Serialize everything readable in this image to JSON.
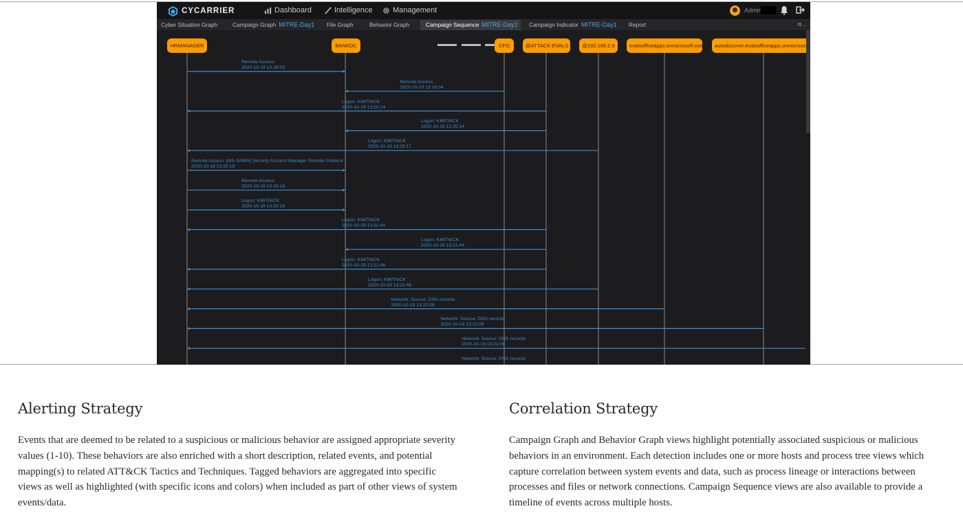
{
  "app": {
    "logo_text": "CYCARRIER",
    "nav": [
      {
        "label": "Dashboard",
        "icon": "bar-chart-icon"
      },
      {
        "label": "Intelligence",
        "icon": "wand-icon"
      },
      {
        "label": "Management",
        "icon": "gear-icon"
      }
    ],
    "user": "Admin",
    "tabs": [
      {
        "label": "Cyber Situation Graph",
        "sub": ""
      },
      {
        "label": "Campaign Graph",
        "sub": "MITRE-Day1"
      },
      {
        "label": "File Graph",
        "sub": ""
      },
      {
        "label": "Behavior Graph",
        "sub": ""
      },
      {
        "label": "Campaign Sequence",
        "sub": "MITRE-Day1",
        "active": true
      },
      {
        "label": "Campaign Indicator",
        "sub": "MITRE-Day1"
      },
      {
        "label": "Report",
        "sub": ""
      }
    ],
    "tab_icons": "⧉ ..",
    "colors": {
      "node": "#ff9d00",
      "line": "#3a8fd0",
      "background": "#1c1b1d"
    }
  },
  "sequence": {
    "actors": [
      "HRMANAGER",
      "BANKDC",
      "CFO",
      "@ATTACK-EVALS",
      "@192.168.2.9",
      "evalsofficeapps.onmicrosoft.com",
      "autodiscover.evalsofficeapps.onmicrosoft.com"
    ],
    "messages": [
      {
        "from": 0,
        "to": 1,
        "label": "Remote Access:",
        "time": "2020-10-19 13:18:03"
      },
      {
        "from": 2,
        "to": 1,
        "label": "Remote Access:",
        "time": "2020-10-19 13:18:04"
      },
      {
        "from": 3,
        "to": 0,
        "label": "Logon: KMITNICK",
        "time": "2020-10-19 13:20:14"
      },
      {
        "from": 3,
        "to": 1,
        "label": "Logon: KMITNICK",
        "time": "2020-10-19 13:20:14"
      },
      {
        "from": 4,
        "to": 0,
        "label": "Logon: KMITNICK",
        "time": "2020-10-19 13:20:17"
      },
      {
        "from": 0,
        "to": 1,
        "label": "Remote Access: [MS-SAMR] Security Account Manager Remote Protocol",
        "time": "2020-10-19 13:20:18"
      },
      {
        "from": 0,
        "to": 1,
        "label": "Remote Access:",
        "time": "2020-10-19 13:20:18"
      },
      {
        "from": 0,
        "to": 1,
        "label": "Logon: KMITNICK",
        "time": "2020-10-19 13:20:18"
      },
      {
        "from": 3,
        "to": 0,
        "label": "Logon: KMITNICK",
        "time": "2020-10-19 13:21:44"
      },
      {
        "from": 3,
        "to": 1,
        "label": "Logon: KMITNICK",
        "time": "2020-10-19 13:21:44"
      },
      {
        "from": 3,
        "to": 0,
        "label": "Logon: KMITNICK",
        "time": "2020-10-19 13:21:46"
      },
      {
        "from": 4,
        "to": 0,
        "label": "Logon: KMITNICK",
        "time": "2020-10-19 13:21:46"
      },
      {
        "from": 5,
        "to": 0,
        "label": "Network: Source: DNS records",
        "time": "2020-10-19 13:22:09"
      },
      {
        "from": 6,
        "to": 0,
        "label": "Network: Source: DNS records",
        "time": "2020-10-19 13:22:09"
      },
      {
        "from": 7,
        "to": 0,
        "label": "Network: Source: DNS records",
        "time": "2020-10-19 13:22:09"
      },
      {
        "from": 7,
        "to": 0,
        "label": "Network: Source: DNS records",
        "time": ""
      }
    ]
  },
  "article": {
    "alerting": {
      "title": "Alerting Strategy",
      "body": "Events that are deemed to be related to a suspicious or malicious behavior are assigned appropriate severity values (1-10). These behaviors are also enriched with a short description, related events, and potential mapping(s) to related ATT&CK Tactics and Techniques. Tagged behaviors are aggregated into specific views as well as highlighted (with specific icons and colors) when included as part of other views of system events/data."
    },
    "correlation": {
      "title": "Correlation Strategy",
      "body": "Campaign Graph and Behavior Graph views highlight potentially associated suspicious or malicious behaviors in an environment. Each detection includes one or more hosts and process tree views which capture correlation between system events and data, such as process lineage or interactions between processes and files or network connections. Campaign Sequence views are also available to provide a timeline of events across multiple hosts."
    }
  }
}
